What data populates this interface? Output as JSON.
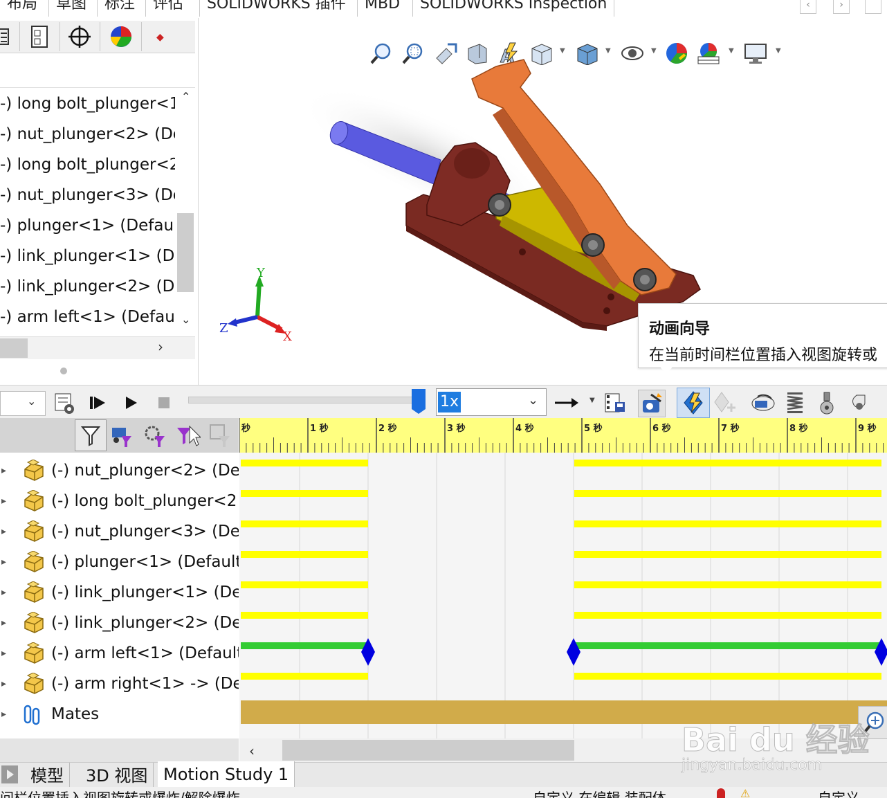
{
  "top_tabs": [
    "布局",
    "草图",
    "标注",
    "评估",
    "SOLIDWORKS 插件",
    "MBD",
    "SOLIDWORKS Inspection"
  ],
  "feature_tree": {
    "items": [
      "-) long bolt_plunger<1",
      "-) nut_plunger<2> (De",
      "-) long bolt_plunger<2",
      "-) nut_plunger<3> (De",
      "-) plunger<1> (Defaul",
      "-) link_plunger<1> (De",
      "-) link_plunger<2> (De",
      "-) arm left<1> (Defaul"
    ]
  },
  "triad": {
    "x": "X",
    "y": "Y",
    "z": "Z"
  },
  "tooltip": {
    "title": "动画向导",
    "body": "在当前时间栏位置插入视图旋转或"
  },
  "motion_toolbar": {
    "speed": "1x"
  },
  "ruler": {
    "labels": [
      "秒",
      "1 秒",
      "2 秒",
      "3 秒",
      "4 秒",
      "5 秒",
      "6 秒",
      "7 秒",
      "8 秒",
      "9 秒"
    ]
  },
  "motion_tree": {
    "items": [
      {
        "label": "(-) nut_plunger<2> (De",
        "icon": "part-icon"
      },
      {
        "label": "(-) long bolt_plunger<2",
        "icon": "part-icon"
      },
      {
        "label": "(-) nut_plunger<3> (De",
        "icon": "part-icon"
      },
      {
        "label": "(-) plunger<1> (Default",
        "icon": "part-icon"
      },
      {
        "label": "(-) link_plunger<1> (De",
        "icon": "part-icon"
      },
      {
        "label": "(-) link_plunger<2> (De",
        "icon": "part-icon"
      },
      {
        "label": "(-) arm left<1> (Default",
        "icon": "part-icon"
      },
      {
        "label": "(-) arm right<1> -> (De",
        "icon": "part-icon"
      },
      {
        "label": "Mates",
        "icon": "mates-icon"
      }
    ]
  },
  "bottom_tabs": [
    "模型",
    "3D 视图",
    "Motion Study 1"
  ],
  "status_bar": {
    "left": "间栏位置插入视图旋转或爆炸/解除爆炸",
    "mid": "自定义  在编辑 装配体",
    "right": "自定义"
  },
  "watermark": {
    "brand": "Bai du 经验",
    "url": "jingyan.baidu.com"
  },
  "colors": {
    "timeline_bar": "#ffff00",
    "timeline_active": "#33cc33",
    "keyframe": "#0000e0",
    "mates_bar": "#d1ab4a",
    "plunger": "#5555dd",
    "base": "#7a2a22",
    "arm": "#e87a3a",
    "link": "#c8b400"
  }
}
